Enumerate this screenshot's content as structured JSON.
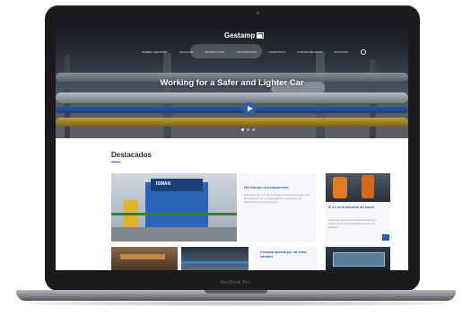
{
  "site": {
    "brand": "Gestamp",
    "nav": [
      "SOBRE GESTAMP",
      "NEGOCIO",
      "PRODUCTOS",
      "ACCIONISTAS",
      "PERSONAS",
      "SOSTENIBILIDAD",
      "NOTICIAS"
    ],
    "hero_title": "Working for a Safer and Lighter Car",
    "section_title": "Destacados",
    "cards": [
      {
        "title": "Del bloque al componente",
        "text": "El proceso de uno de los bloques de la cadena de valor del producto con el desarrollo de una acería y la fabricación de componentes."
      },
      {
        "title": "El 4.0 en la industria del futuro",
        "text": "Gestamp apuesta por la transformación digital para mejorar la eficiencia de sus plantas."
      },
      {
        "title": "Gestamp apuesta por las ferias virtuales"
      }
    ],
    "press_label": "ISMAN"
  },
  "device": {
    "model": "MacBook Pro"
  },
  "colors": {
    "accent": "#2e5ea8",
    "laptop_body": "#1b1b1e"
  }
}
